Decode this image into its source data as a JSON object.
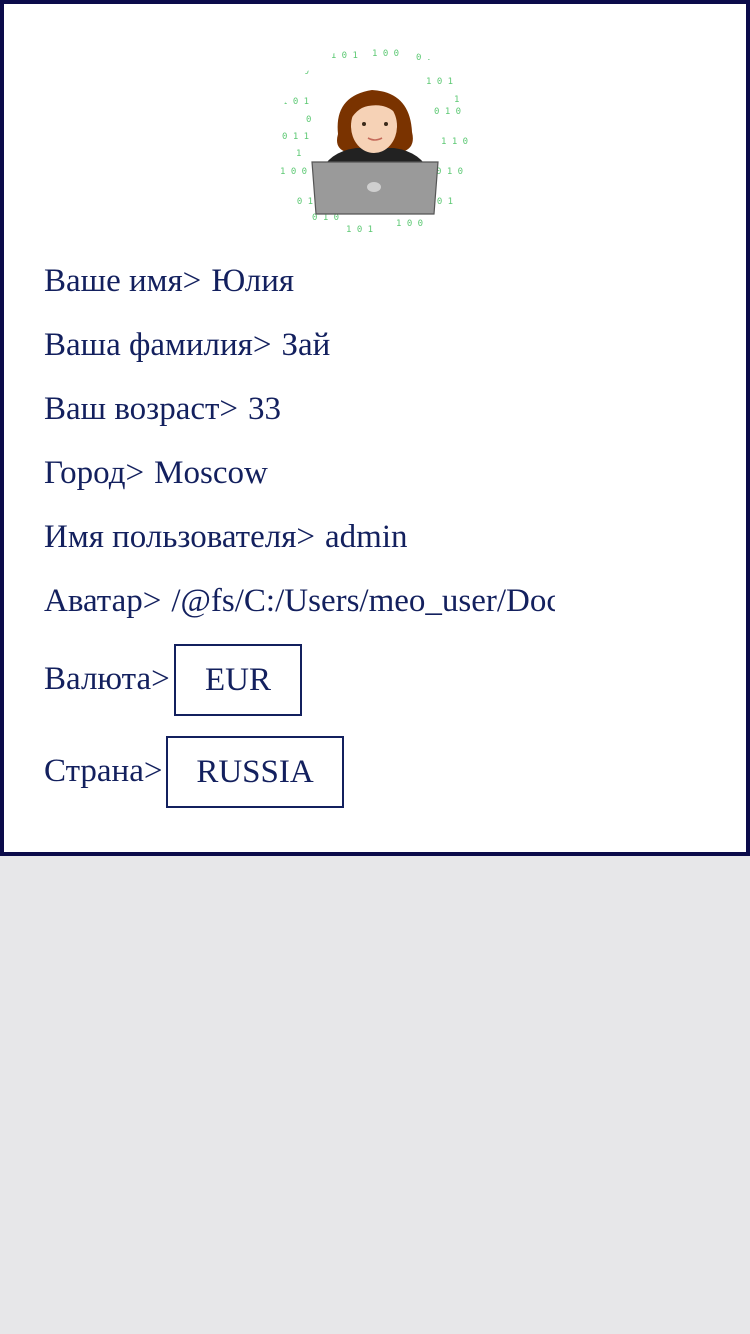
{
  "profile": {
    "avatar_icon": "woman-with-laptop-matrix-avatar",
    "fields": [
      {
        "label": "Ваше имя>",
        "value": "Юлия"
      },
      {
        "label": "Ваша фамилия>",
        "value": "Зай"
      },
      {
        "label": "Ваш возраст>",
        "value": "33"
      },
      {
        "label": "Город>",
        "value": "Moscow"
      },
      {
        "label": "Имя пользователя>",
        "value": "admin"
      },
      {
        "label": "Аватар>",
        "value": "/@fs/C:/Users/meo_user/Docu"
      }
    ],
    "currency": {
      "label": "Валюта>",
      "value": "EUR"
    },
    "country": {
      "label": "Страна>",
      "value": "RUSSIA"
    }
  },
  "colors": {
    "text": "#13205e",
    "border": "#0b0b4a",
    "background": "#e7e7e9",
    "matrix": "#3fbf5a",
    "hair": "#7a3300"
  }
}
